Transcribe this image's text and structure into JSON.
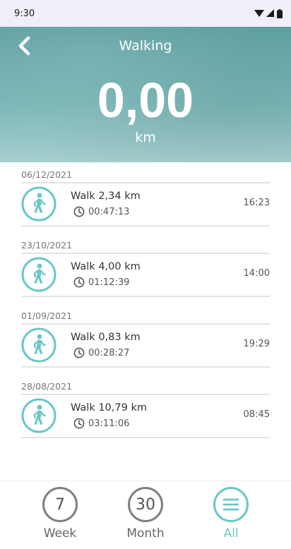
{
  "status_bar": {
    "time": "9:30"
  },
  "header": {
    "title": "Walking",
    "distance": "0,00",
    "unit": "km"
  },
  "activities": [
    {
      "date": "06/12/2021",
      "title": "Walk 2,34 km",
      "duration": "00:47:13",
      "time": "16:23"
    },
    {
      "date": "23/10/2021",
      "title": "Walk 4,00 km",
      "duration": "01:12:39",
      "time": "14:00"
    },
    {
      "date": "01/09/2021",
      "title": "Walk 0,83 km",
      "duration": "00:28:27",
      "time": "19:29"
    },
    {
      "date": "28/08/2021",
      "title": "Walk 10,79 km",
      "duration": "03:11:06",
      "time": "08:45"
    }
  ],
  "bottom_nav": {
    "week": {
      "number": "7",
      "label": "Week"
    },
    "month": {
      "number": "30",
      "label": "Month"
    },
    "all": {
      "label": "All"
    }
  },
  "colors": {
    "accent": "#6cc6c9",
    "header": "#5e9fa1"
  }
}
